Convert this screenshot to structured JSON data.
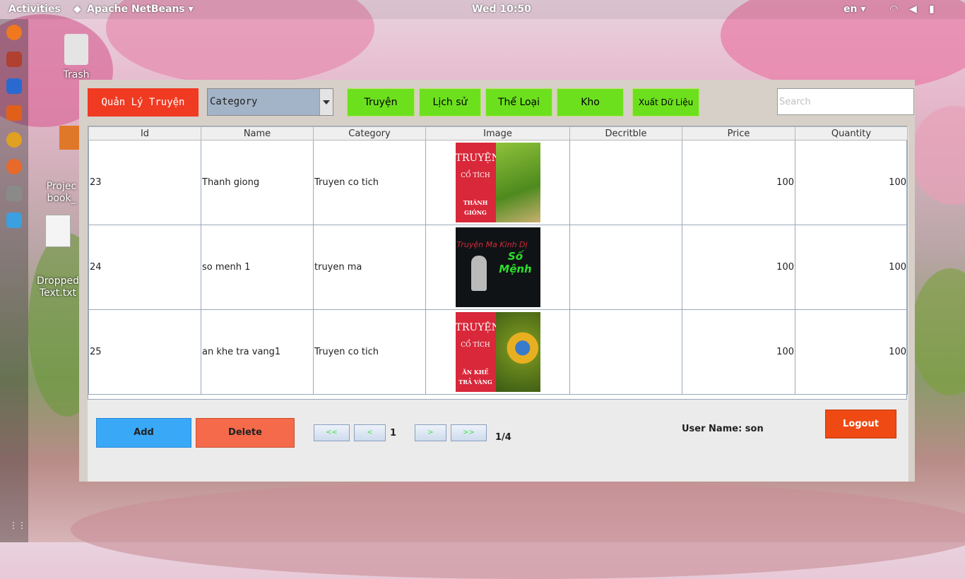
{
  "topbar": {
    "activities": "Activities",
    "app_name": "Apache NetBeans ▾",
    "clock": "Wed 10:50",
    "lang": "en ▾"
  },
  "desktop": {
    "icons": [
      {
        "label": "Trash"
      },
      {
        "label": "Projec\nbook_"
      },
      {
        "label": "Dropped\nText.txt"
      }
    ]
  },
  "app": {
    "title_button": "Quản Lý Truyện",
    "category_select": "Category",
    "nav": [
      "Truyện",
      "Lịch sử",
      "Thể Loại",
      "Kho",
      "Xuất Dữ Liệu"
    ],
    "search_placeholder": "Search",
    "table": {
      "columns": [
        "Id",
        "Name",
        "Category",
        "Image",
        "Decritble",
        "Price",
        "Quantity"
      ],
      "rows": [
        {
          "id": "23",
          "name": "Thanh giong",
          "category": "Truyen co tich",
          "image": {
            "line1": "TRUYỆN",
            "line2": "CỔ TÍCH",
            "line3": "THÁNH GIÓNG"
          },
          "desc": "",
          "price": "100",
          "qty": "100"
        },
        {
          "id": "24",
          "name": "so menh 1",
          "category": "truyen ma",
          "image": {
            "line1": "Truyện Ma Kinh Dị",
            "line2": "Số Mệnh"
          },
          "desc": "",
          "price": "100",
          "qty": "100"
        },
        {
          "id": "25",
          "name": "an khe tra vang1",
          "category": "Truyen co tich",
          "image": {
            "line1": "TRUYỆN",
            "line2": "CỔ TÍCH",
            "line3": "ĂN KHẾ TRẢ VÀNG"
          },
          "desc": "",
          "price": "100",
          "qty": "100"
        }
      ]
    },
    "actions": {
      "add": "Add",
      "delete": "Delete",
      "logout": "Logout"
    },
    "pagination": {
      "first": "<<",
      "prev": "<",
      "current": "1",
      "next": ">",
      "last": ">>",
      "total": "1/4"
    },
    "user_label": "User Name: son"
  }
}
